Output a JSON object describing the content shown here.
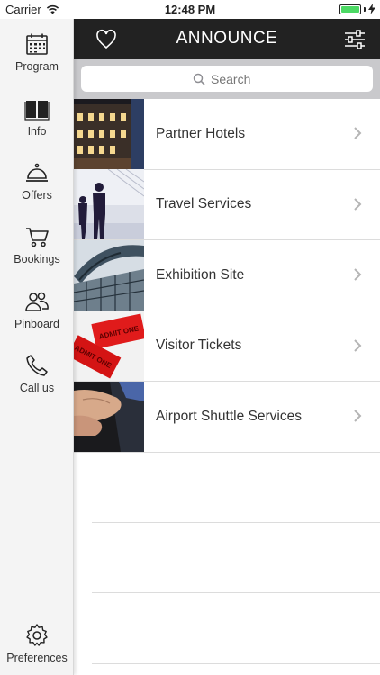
{
  "status": {
    "carrier": "Carrier",
    "time": "12:48 PM"
  },
  "sidebar": {
    "items": [
      {
        "label": "Program",
        "icon": "calendar-icon"
      },
      {
        "label": "Info",
        "icon": "book-icon"
      },
      {
        "label": "Offers",
        "icon": "service-bell-icon"
      },
      {
        "label": "Bookings",
        "icon": "cart-icon"
      },
      {
        "label": "Pinboard",
        "icon": "people-icon"
      },
      {
        "label": "Call us",
        "icon": "phone-icon"
      },
      {
        "label": "Preferences",
        "icon": "gear-icon"
      }
    ]
  },
  "header": {
    "title": "ANNOUNCE",
    "left_icon": "heart-icon",
    "right_icon": "sliders-icon"
  },
  "search": {
    "placeholder": "Search"
  },
  "list": {
    "items": [
      {
        "label": "Partner Hotels",
        "thumb": "hotel-photo"
      },
      {
        "label": "Travel Services",
        "thumb": "travelers-photo"
      },
      {
        "label": "Exhibition Site",
        "thumb": "exhibition-hall-photo"
      },
      {
        "label": "Visitor Tickets",
        "thumb": "tickets-photo"
      },
      {
        "label": "Airport Shuttle Services",
        "thumb": "handshake-photo"
      }
    ],
    "ticket_text": "ADMIT ONE"
  },
  "colors": {
    "header_bg": "#222222",
    "sidebar_bg": "#f4f4f4",
    "search_bg": "#c9c9cc",
    "battery": "#4cd964"
  }
}
